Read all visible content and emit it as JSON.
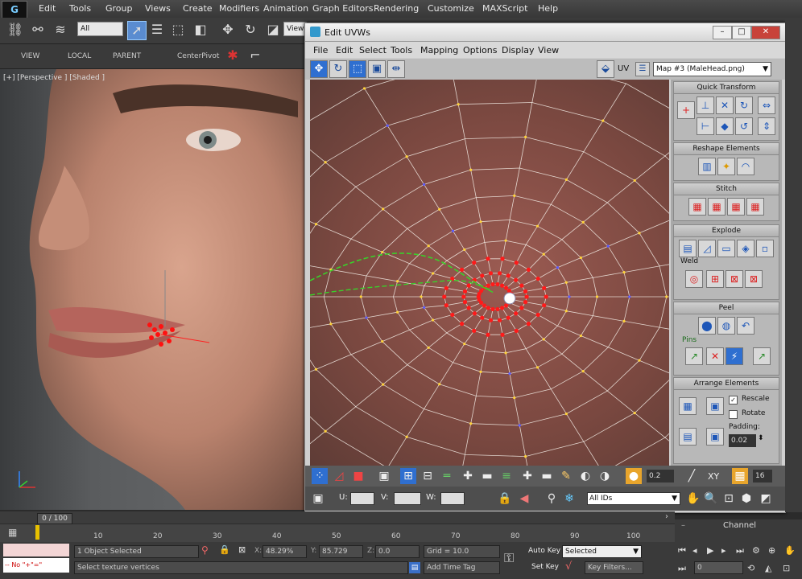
{
  "menubar": {
    "logo": "G",
    "items": [
      "Edit",
      "Tools",
      "Group",
      "Views",
      "Create",
      "Modifiers",
      "Animation",
      "Graph Editors",
      "Rendering",
      "Customize",
      "MAXScript",
      "Help"
    ]
  },
  "toolbar": {
    "selection_filter": "All",
    "view_dropdown": "View"
  },
  "toolbar2": {
    "labels": [
      "VIEW",
      "LOCAL",
      "PARENT",
      "CenterPivot"
    ]
  },
  "viewport": {
    "label": "[+] [Perspective ] [Shaded ]"
  },
  "uv_window": {
    "title": "Edit UVWs",
    "menu": [
      "File",
      "Edit",
      "Select",
      "Tools",
      "Mapping",
      "Options",
      "Display",
      "View"
    ],
    "uv_label": "UV",
    "map_selector": "Map #3 (MaleHead.png)",
    "panel": {
      "quick_transform": "Quick Transform",
      "reshape_elements": "Reshape Elements",
      "stitch": "Stitch",
      "explode": "Explode",
      "weld": "Weld",
      "peel": "Peel",
      "pins": "Pins",
      "arrange_elements": "Arrange Elements",
      "rescale": "Rescale",
      "rotate": "Rotate",
      "padding_label": "Padding:",
      "padding_value": "0.02"
    },
    "bottom": {
      "spinner_value": "0.2",
      "xy_label": "XY",
      "count": "16",
      "u_label": "U:",
      "v_label": "V:",
      "w_label": "W:",
      "ids_dropdown": "All IDs"
    }
  },
  "timeline": {
    "frame_counter": "0 / 100",
    "ticks": [
      "10",
      "20",
      "30",
      "40",
      "50",
      "60",
      "70",
      "80",
      "90",
      "100"
    ]
  },
  "status": {
    "objects_selected": "1 Object Selected",
    "prompt": "Select texture vertices",
    "x_label": "X:",
    "x_value": "48.29%",
    "y_label": "Y:",
    "y_value": "85.729",
    "z_label": "Z:",
    "z_value": "0.0",
    "grid": "Grid = 10.0",
    "add_time_tag": "Add Time Tag",
    "script_listener": "-- No \"+\"=\""
  },
  "animation": {
    "auto_key": "Auto Key",
    "selected": "Selected",
    "set_key": "Set Key",
    "key_filters": "Key Filters...",
    "frame": "0",
    "channel": "Channel"
  }
}
